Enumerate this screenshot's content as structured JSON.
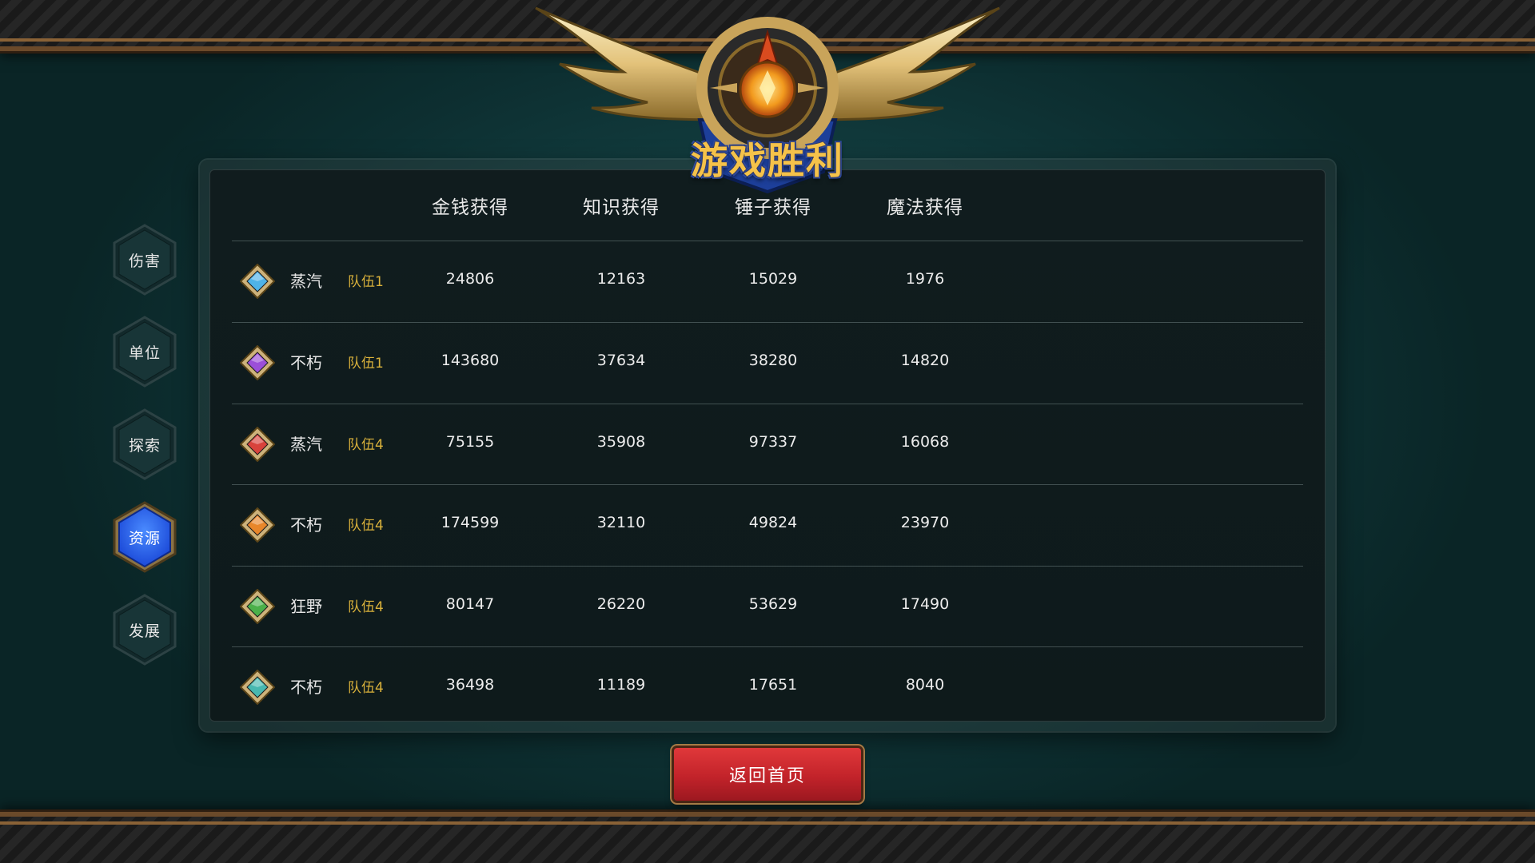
{
  "emblem": {
    "title": "游戏胜利"
  },
  "sidebar": {
    "items": [
      {
        "label": "伤害",
        "active": false
      },
      {
        "label": "单位",
        "active": false
      },
      {
        "label": "探索",
        "active": false
      },
      {
        "label": "资源",
        "active": true
      },
      {
        "label": "发展",
        "active": false
      }
    ]
  },
  "table": {
    "columns": [
      "金钱获得",
      "知识获得",
      "锤子获得",
      "魔法获得"
    ],
    "rows": [
      {
        "gem_color": "#4fb3e8",
        "faction": "蒸汽",
        "team": "队伍1",
        "values": [
          "24806",
          "12163",
          "15029",
          "1976"
        ]
      },
      {
        "gem_color": "#9b4fd8",
        "faction": "不朽",
        "team": "队伍1",
        "values": [
          "143680",
          "37634",
          "38280",
          "14820"
        ]
      },
      {
        "gem_color": "#d8433c",
        "faction": "蒸汽",
        "team": "队伍4",
        "values": [
          "75155",
          "35908",
          "97337",
          "16068"
        ]
      },
      {
        "gem_color": "#e8862a",
        "faction": "不朽",
        "team": "队伍4",
        "values": [
          "174599",
          "32110",
          "49824",
          "23970"
        ]
      },
      {
        "gem_color": "#4bb04a",
        "faction": "狂野",
        "team": "队伍4",
        "values": [
          "80147",
          "26220",
          "53629",
          "17490"
        ]
      },
      {
        "gem_color": "#48b8b0",
        "faction": "不朽",
        "team": "队伍4",
        "values": [
          "36498",
          "11189",
          "17651",
          "8040"
        ]
      }
    ]
  },
  "footer": {
    "return_label": "返回首页"
  }
}
